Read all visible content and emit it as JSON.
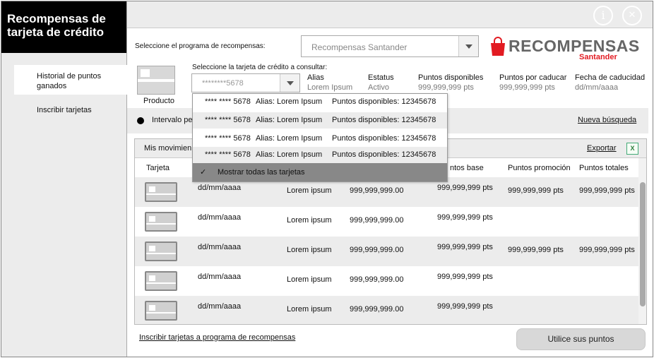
{
  "sidebar": {
    "title": "Recompensas de tarjeta de crédito",
    "items": [
      {
        "label": "Historial de puntos ganados",
        "active": true
      },
      {
        "label": "Inscribir tarjetas",
        "active": false
      }
    ]
  },
  "topbar": {
    "info_icon": "info-icon",
    "collapse_icon": "collapse-icon"
  },
  "program": {
    "label": "Seleccione el programa de recompensas:",
    "selected": "Recompensas Santander"
  },
  "logo": {
    "main": "RECOMPENSAS",
    "sub": "Santander",
    "color": "#e21b22"
  },
  "card_select": {
    "label": "Seleccione la tarjeta de crédito a consultar:",
    "value": "********5678",
    "product_label": "Producto"
  },
  "card_info": [
    {
      "label": "Alias",
      "value": "Lorem Ipsum"
    },
    {
      "label": "Estatus",
      "value": "Activo"
    },
    {
      "label": "Puntos disponibles",
      "value": "999,999,999 pts"
    },
    {
      "label": "Puntos por caducar",
      "value": "999,999,999 pts"
    },
    {
      "label": "Fecha de caducidad",
      "value": "dd/mm/aaaa"
    }
  ],
  "filter": {
    "label": "Intervalo pe",
    "new_search": "Nueva búsqueda"
  },
  "movements": {
    "title": "Mis movimien",
    "export": "Exportar",
    "columns": [
      "Tarjeta",
      "ntos base",
      "Puntos promoción",
      "Puntos totales"
    ],
    "rows": [
      {
        "date": "dd/mm/aaaa",
        "desc": "Lorem ipsum",
        "amount": "999,999,999.00",
        "base": "999,999,999 pts",
        "promo": "999,999,999 pts",
        "total": "999,999,999 pts"
      },
      {
        "date": "dd/mm/aaaa",
        "desc": "Lorem ipsum",
        "amount": "999,999,999.00",
        "base": "999,999,999 pts",
        "promo": "",
        "total": ""
      },
      {
        "date": "dd/mm/aaaa",
        "desc": "Lorem ipsum",
        "amount": "999,999,999.00",
        "base": "999,999,999 pts",
        "promo": "999,999,999 pts",
        "total": "999,999,999 pts"
      },
      {
        "date": "dd/mm/aaaa",
        "desc": "Lorem ipsum",
        "amount": "999,999,999.00",
        "base": "999,999,999 pts",
        "promo": "",
        "total": ""
      },
      {
        "date": "dd/mm/aaaa",
        "desc": "Lorem ipsum",
        "amount": "999,999,999.00",
        "base": "999,999,999 pts",
        "promo": "",
        "total": ""
      }
    ]
  },
  "dropdown": {
    "items": [
      {
        "number": "**** **** 5678",
        "alias": "Alias: Lorem Ipsum",
        "points": "Puntos disponibles: 12345678"
      },
      {
        "number": "**** **** 5678",
        "alias": "Alias: Lorem Ipsum",
        "points": "Puntos disponibles: 12345678"
      },
      {
        "number": "**** **** 5678",
        "alias": "Alias: Lorem Ipsum",
        "points": "Puntos disponibles: 12345678"
      },
      {
        "number": "**** **** 5678",
        "alias": "Alias: Lorem Ipsum",
        "points": "Puntos disponibles: 12345678"
      }
    ],
    "show_all": "Mostrar todas las tarjetas",
    "check": "✓"
  },
  "footer": {
    "enroll_link": "Inscribir tarjetas a programa de recompensas",
    "use_points": "Utilice sus puntos"
  }
}
